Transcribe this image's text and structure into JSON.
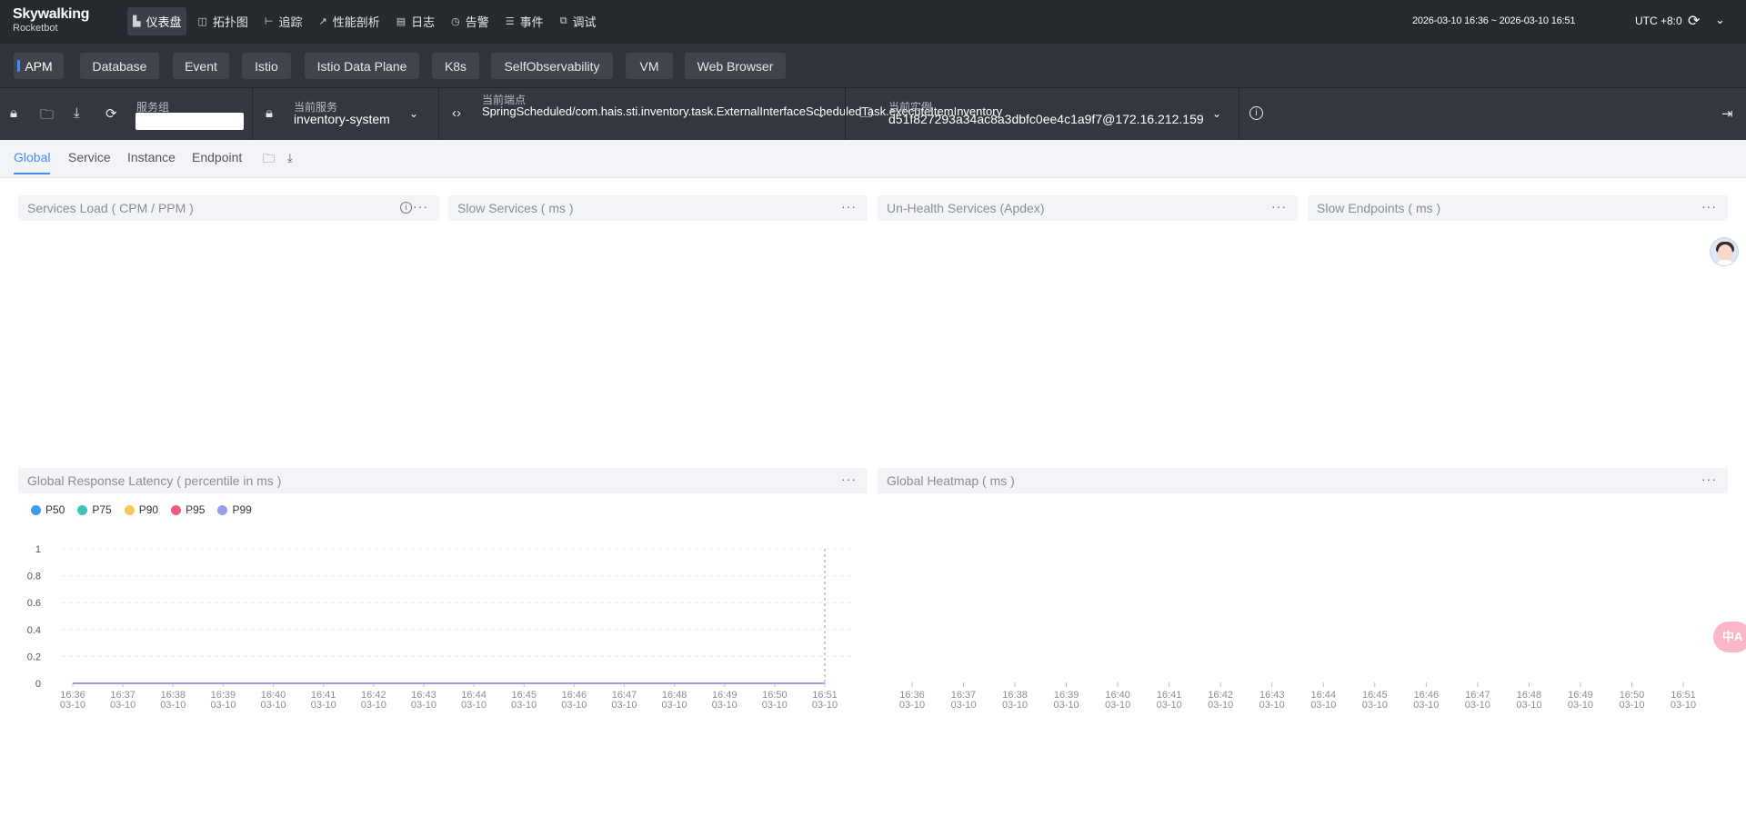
{
  "app": {
    "logo_line1": "Skywalking",
    "logo_line2": "Rocketbot"
  },
  "menu": [
    {
      "label": "仪表盘",
      "icon": "dashboard-icon",
      "active": true
    },
    {
      "label": "拓扑图",
      "icon": "topology-icon"
    },
    {
      "label": "追踪",
      "icon": "trace-icon"
    },
    {
      "label": "性能剖析",
      "icon": "profile-icon"
    },
    {
      "label": "日志",
      "icon": "log-icon"
    },
    {
      "label": "告警",
      "icon": "alarm-icon"
    },
    {
      "label": "事件",
      "icon": "event-icon"
    },
    {
      "label": "调试",
      "icon": "debug-icon"
    }
  ],
  "header": {
    "time_range": "2026-03-10 16:36 ~ 2026-03-10 16:51",
    "timezone": "UTC +8:0"
  },
  "layers": [
    "APM",
    "Database",
    "Event",
    "Istio",
    "Istio Data Plane",
    "K8s",
    "SelfObservability",
    "VM",
    "Web Browser"
  ],
  "selectors": {
    "group_label": "服务组",
    "group_value": "",
    "service_label": "当前服务",
    "service_value": "inventory-system",
    "endpoint_label": "当前端点",
    "endpoint_value": "SpringScheduled/com.hais.sti.inventory.task.ExternalInterfaceScheduledTask.executeItemInventory",
    "instance_label": "当前实例",
    "instance_value": "d51f827293a34ac8a3dbfc0ee4c1a9f7@172.16.212.159"
  },
  "tabs": [
    "Global",
    "Service",
    "Instance",
    "Endpoint"
  ],
  "widgets": {
    "services_load": "Services Load ( CPM / PPM )",
    "slow_services": "Slow Services ( ms )",
    "unhealth_services": "Un-Health Services (Apdex)",
    "slow_endpoints": "Slow Endpoints ( ms )",
    "global_latency": "Global Response Latency ( percentile in ms )",
    "global_heatmap": "Global Heatmap ( ms )"
  },
  "more_glyph": "···",
  "translate_label": "中A",
  "chart_data": [
    {
      "type": "line",
      "title": "Global Response Latency ( percentile in ms )",
      "x": [
        "16:36\n03-10",
        "16:37\n03-10",
        "16:38\n03-10",
        "16:39\n03-10",
        "16:40\n03-10",
        "16:41\n03-10",
        "16:42\n03-10",
        "16:43\n03-10",
        "16:44\n03-10",
        "16:45\n03-10",
        "16:46\n03-10",
        "16:47\n03-10",
        "16:48\n03-10",
        "16:49\n03-10",
        "16:50\n03-10",
        "16:51\n03-10"
      ],
      "yticks": [
        "0",
        "0.2",
        "0.4",
        "0.6",
        "0.8",
        "1"
      ],
      "ylim": [
        0,
        1
      ],
      "legend_position": "top-left",
      "series": [
        {
          "name": "P50",
          "color": "#3b9cf0",
          "values": [
            0,
            0,
            0,
            0,
            0,
            0,
            0,
            0,
            0,
            0,
            0,
            0,
            0,
            0,
            0,
            0
          ]
        },
        {
          "name": "P75",
          "color": "#3ec2b6",
          "values": [
            0,
            0,
            0,
            0,
            0,
            0,
            0,
            0,
            0,
            0,
            0,
            0,
            0,
            0,
            0,
            0
          ]
        },
        {
          "name": "P90",
          "color": "#fac858",
          "values": [
            0,
            0,
            0,
            0,
            0,
            0,
            0,
            0,
            0,
            0,
            0,
            0,
            0,
            0,
            0,
            0
          ]
        },
        {
          "name": "P95",
          "color": "#f25b7c",
          "values": [
            0,
            0,
            0,
            0,
            0,
            0,
            0,
            0,
            0,
            0,
            0,
            0,
            0,
            0,
            0,
            0
          ]
        },
        {
          "name": "P99",
          "color": "#9a9de8",
          "values": [
            0,
            0,
            0,
            0,
            0,
            0,
            0,
            0,
            0,
            0,
            0,
            0,
            0,
            0,
            0,
            0
          ]
        }
      ]
    },
    {
      "type": "heatmap",
      "title": "Global Heatmap ( ms )",
      "x": [
        "16:36\n03-10",
        "16:37\n03-10",
        "16:38\n03-10",
        "16:39\n03-10",
        "16:40\n03-10",
        "16:41\n03-10",
        "16:42\n03-10",
        "16:43\n03-10",
        "16:44\n03-10",
        "16:45\n03-10",
        "16:46\n03-10",
        "16:47\n03-10",
        "16:48\n03-10",
        "16:49\n03-10",
        "16:50\n03-10",
        "16:51\n03-10"
      ],
      "values": []
    }
  ]
}
